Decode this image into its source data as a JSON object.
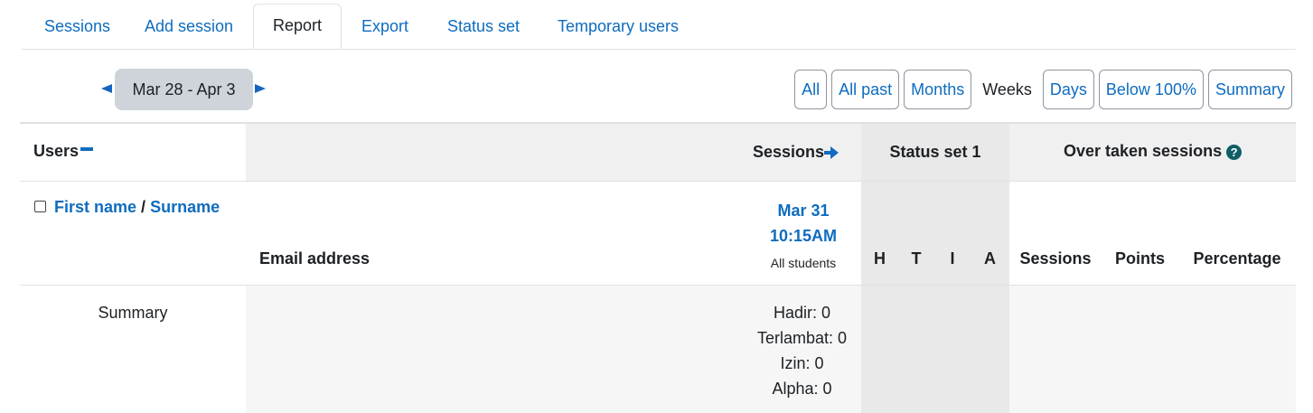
{
  "tabs": [
    {
      "label": "Sessions"
    },
    {
      "label": "Add session"
    },
    {
      "label": "Report"
    },
    {
      "label": "Export"
    },
    {
      "label": "Status set"
    },
    {
      "label": "Temporary users"
    }
  ],
  "active_tab": "Report",
  "date_nav": {
    "range": "Mar 28 - Apr 3"
  },
  "filters": {
    "all": "All",
    "all_past": "All past",
    "months": "Months",
    "current": "Weeks",
    "days": "Days",
    "below": "Below 100%",
    "summary": "Summary"
  },
  "table": {
    "users_header": "Users",
    "sessions_header": "Sessions",
    "status_set_header": "Status set 1",
    "over_taken_header": "Over taken sessions",
    "help_glyph": "?",
    "first_name": "First name",
    "name_sep": " / ",
    "surname": "Surname",
    "email_header": "Email address",
    "session": {
      "date": "Mar 31",
      "time": "10:15AM",
      "group": "All students"
    },
    "status_cols": [
      "H",
      "T",
      "I",
      "A"
    ],
    "over_cols": [
      "Sessions",
      "Points",
      "Percentage"
    ],
    "summary_label": "Summary",
    "summary_stats": [
      "Hadir: 0",
      "Terlambat: 0",
      "Izin: 0",
      "Alpha: 0"
    ]
  },
  "colors": {
    "link": "#0f6cbf",
    "help_icon": "#115e67"
  }
}
